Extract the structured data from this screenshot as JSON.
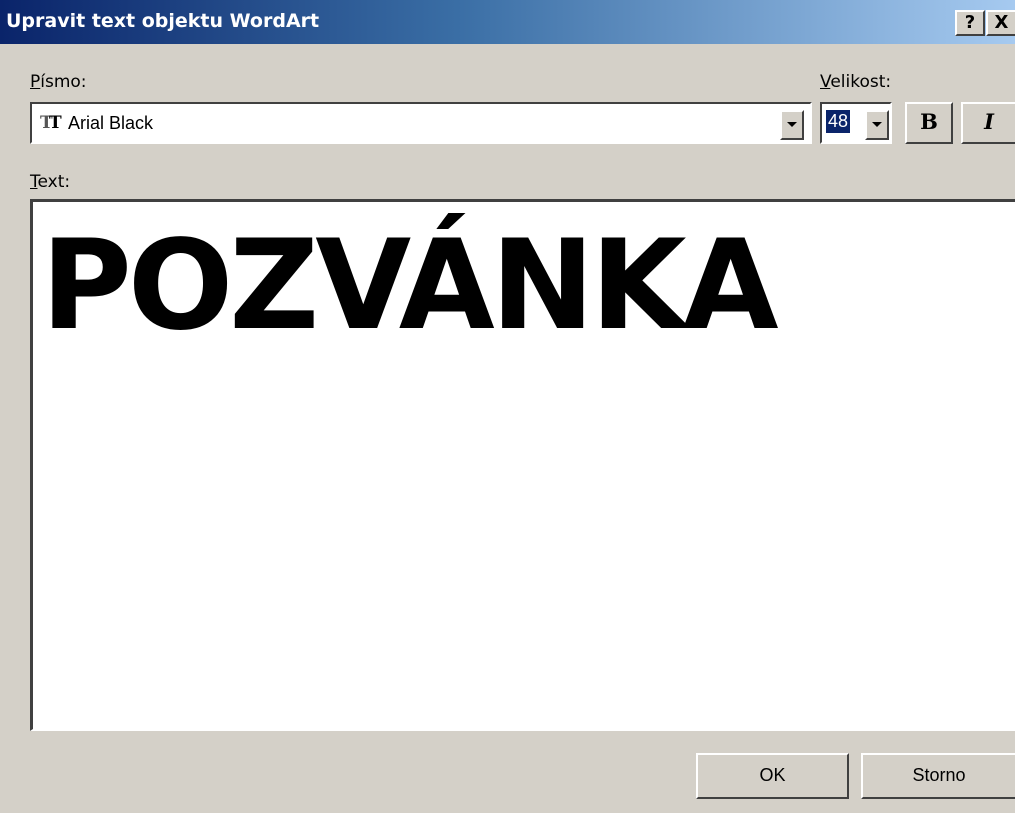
{
  "window": {
    "title": "Upravit text objektu WordArt",
    "help_label": "?",
    "close_label": "X"
  },
  "font": {
    "label_accel": "P",
    "label_rest": "ísmo:",
    "value": "Arial Black",
    "icon": "truetype-font-icon",
    "icon_glyph_1": "T",
    "icon_glyph_2": "T"
  },
  "size": {
    "label_accel": "V",
    "label_rest": "elikost:",
    "value": "48"
  },
  "format": {
    "bold_label": "B",
    "italic_label": "I"
  },
  "text": {
    "label_accel": "T",
    "label_rest": "ext:",
    "content": "POZVÁNKA"
  },
  "buttons": {
    "ok_label": "OK",
    "cancel_label": "Storno"
  },
  "colors": {
    "title_gradient_start": "#0a246a",
    "title_gradient_end": "#a6caf0",
    "dialog_face": "#d4d0c8",
    "selection": "#0a246a"
  }
}
